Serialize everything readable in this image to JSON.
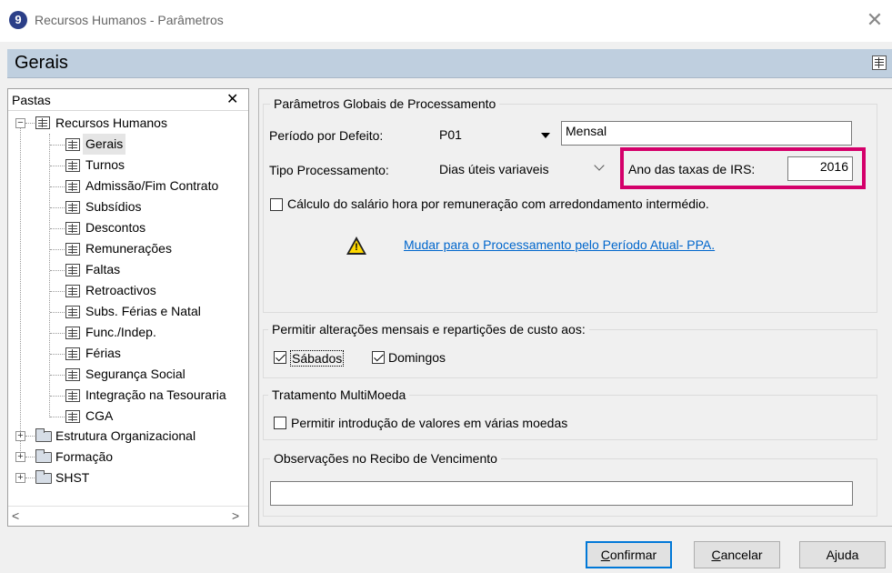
{
  "window": {
    "app_icon_glyph": "9",
    "title": "Recursos Humanos - Parâmetros",
    "close_glyph": "✕"
  },
  "section": {
    "title": "Gerais"
  },
  "left_panel": {
    "header": "Pastas",
    "close_glyph": "✕",
    "tree": [
      {
        "label": "Recursos Humanos",
        "type": "root",
        "expanded": true
      },
      {
        "label": "Gerais",
        "type": "doc",
        "selected": true
      },
      {
        "label": "Turnos",
        "type": "doc"
      },
      {
        "label": "Admissão/Fim Contrato",
        "type": "doc"
      },
      {
        "label": "Subsídios",
        "type": "doc"
      },
      {
        "label": "Descontos",
        "type": "doc"
      },
      {
        "label": "Remunerações",
        "type": "doc"
      },
      {
        "label": "Faltas",
        "type": "doc"
      },
      {
        "label": "Retroactivos",
        "type": "doc"
      },
      {
        "label": "Subs. Férias e Natal",
        "type": "doc"
      },
      {
        "label": "Func./Indep.",
        "type": "doc"
      },
      {
        "label": "Férias",
        "type": "doc"
      },
      {
        "label": "Segurança Social",
        "type": "doc"
      },
      {
        "label": "Integração na Tesouraria",
        "type": "doc"
      },
      {
        "label": "CGA",
        "type": "doc"
      },
      {
        "label": "Estrutura Organizacional",
        "type": "folder"
      },
      {
        "label": "Formação",
        "type": "folder"
      },
      {
        "label": "SHST",
        "type": "folder"
      }
    ],
    "scroll_left": "<",
    "scroll_right": ">"
  },
  "global_params": {
    "group_title": "Parâmetros Globais de Processamento",
    "periodo_label": "Período por Defeito:",
    "periodo_code": "P01",
    "periodo_desc": "Mensal",
    "tipo_label": "Tipo Processamento:",
    "tipo_value": "Dias úteis variaveis",
    "irs_label": "Ano das taxas de IRS:",
    "irs_value": "2016",
    "calc_checkbox_label": "Cálculo do salário hora por remuneração com arredondamento intermédio.",
    "calc_checked": false,
    "warning_mark": "!",
    "ppa_link": "Mudar para o Processamento pelo Período Atual- PPA."
  },
  "monthly_changes": {
    "group_title": "Permitir alterações mensais e repartições de custo aos:",
    "sabados_label": "Sábados",
    "sabados_checked": true,
    "domingos_label": "Domingos",
    "domingos_checked": true
  },
  "multicurrency": {
    "group_title": "Tratamento MultiMoeda",
    "checkbox_label": "Permitir introdução de valores em várias moedas",
    "checked": false
  },
  "receipt_notes": {
    "group_title": "Observações no Recibo de Vencimento",
    "value": ""
  },
  "buttons": {
    "confirm_first": "C",
    "confirm_rest": "onfirmar",
    "cancel_first": "C",
    "cancel_rest": "ancelar",
    "help": "Ajuda"
  },
  "colors": {
    "header_bg": "#bfcfdf",
    "highlight": "#d4006a",
    "link": "#0066cc",
    "default_button_border": "#0078d7"
  }
}
